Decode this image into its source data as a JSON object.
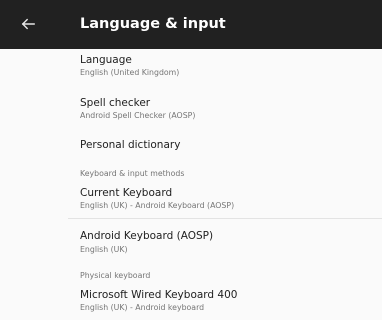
{
  "appbar": {
    "title": "Language & input",
    "back_icon": "arrow-left-icon"
  },
  "items": {
    "language": {
      "title": "Language",
      "summary": "English (United Kingdom)"
    },
    "spell_checker": {
      "title": "Spell checker",
      "summary": "Android Spell Checker (AOSP)"
    },
    "personal_dictionary": {
      "title": "Personal dictionary"
    },
    "current_keyboard": {
      "title": "Current Keyboard",
      "summary": "English (UK) - Android Keyboard (AOSP)"
    },
    "android_keyboard": {
      "title": "Android Keyboard (AOSP)",
      "summary": "English (UK)"
    },
    "wired_keyboard": {
      "title": "Microsoft Wired Keyboard 400",
      "summary": "English (UK) - Android keyboard"
    }
  },
  "categories": {
    "keyboard_input": "Keyboard & input methods",
    "physical_keyboard": "Physical keyboard"
  },
  "colors": {
    "appbar": "#212121",
    "background": "#fafafa",
    "primary_text": "#212121",
    "secondary_text": "#757575"
  }
}
